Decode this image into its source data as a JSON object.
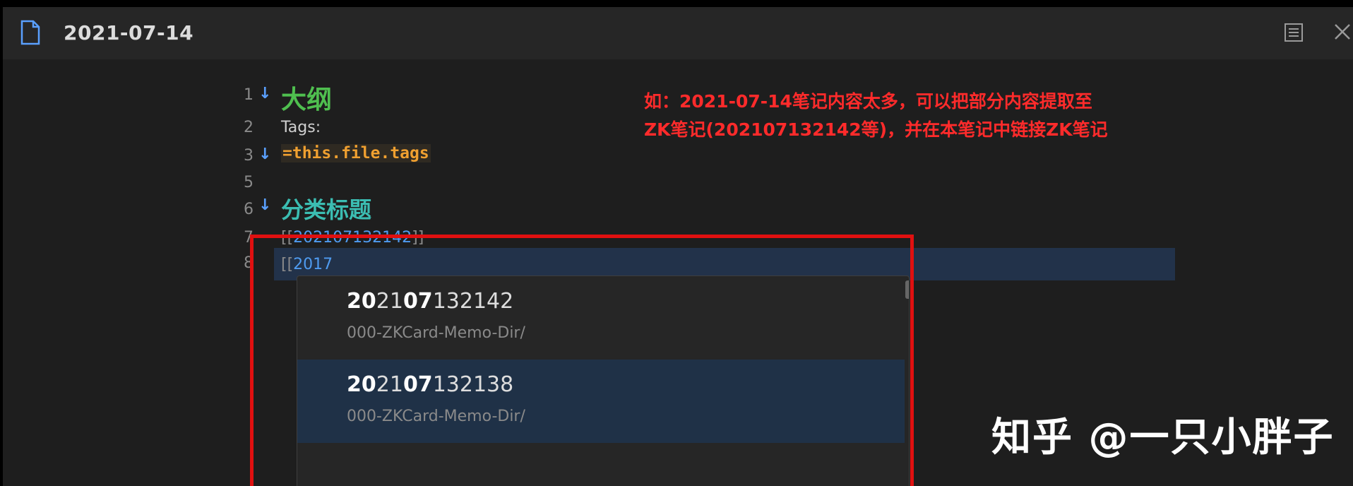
{
  "tab": {
    "title": "2021-07-14"
  },
  "icons": {
    "file": "file-icon",
    "reading": "reading-view-icon",
    "close": "close-icon",
    "fold": "fold-arrow-icon"
  },
  "editor": {
    "lines": [
      {
        "num": "1",
        "text": "大纲"
      },
      {
        "num": "2",
        "text": "Tags:"
      },
      {
        "num": "3",
        "text": "=this.file.tags"
      },
      {
        "num": "5",
        "text": ""
      },
      {
        "num": "6",
        "text": "分类标题"
      },
      {
        "num": "7",
        "link_open": "[[",
        "link": "202107132142",
        "link_close": "]]"
      },
      {
        "num": "8",
        "link_open": "[[",
        "link": "2017"
      }
    ]
  },
  "annotation": {
    "line1": "如：2021-07-14笔记内容太多，可以把部分内容提取至",
    "line2": "ZK笔记(202107132142等)，并在本笔记中链接ZK笔记"
  },
  "suggestions": [
    {
      "title_bold1": "20",
      "title_mid": "21",
      "title_bold2": "07",
      "title_rest": "132142",
      "path": "000-ZKCard-Memo-Dir/"
    },
    {
      "title_bold1": "20",
      "title_mid": "21",
      "title_bold2": "07",
      "title_rest": "132138",
      "path": "000-ZKCard-Memo-Dir/"
    }
  ],
  "watermark": "知乎 @一只小胖子",
  "colors": {
    "annotation": "#ff2b2b",
    "highlight_box": "#e01010",
    "link": "#4f9bf0",
    "heading1": "#4fbf4f",
    "heading2": "#3bbdb2"
  }
}
